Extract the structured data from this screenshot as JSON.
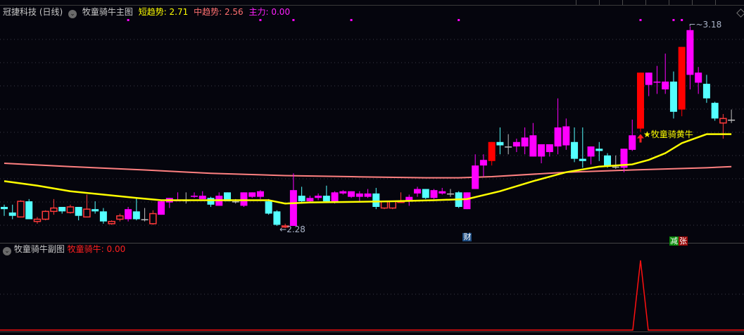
{
  "header": {
    "stock_name": "冠捷科技 (日线)",
    "indicator_name": "牧童骑牛主图",
    "short_trend_label": "短趋势: 2.71",
    "mid_trend_label": "中趋势: 2.56",
    "main_force_label": "主力: 0.00"
  },
  "sub_header": {
    "indicator_name": "牧童骑牛副图",
    "value_label": "牧童骑牛: 0.00"
  },
  "annotations": {
    "high_label": "3.18",
    "low_label": "2.28",
    "signal_label": "★牧童骑黄牛",
    "badge_cai": "财",
    "badge_jian": "减",
    "badge_zhang": "张"
  },
  "colors": {
    "background": "#05050d",
    "up_strong": "#ff00ff",
    "down": "#54ffff",
    "up_red": "#ff0000",
    "hollow": "#ff3a3a",
    "doji": "#c0c0c0",
    "short_trend": "#ffff00",
    "mid_trend": "#ff8080"
  },
  "chart_data": {
    "type": "candlestick",
    "price_axis_range": [
      2.28,
      3.18
    ],
    "candles": [
      [
        2.375,
        2.365,
        2.385,
        2.335,
        "c"
      ],
      [
        2.35,
        2.335,
        2.385,
        2.32,
        "c"
      ],
      [
        2.33,
        2.4,
        2.405,
        2.33,
        "h"
      ],
      [
        2.4,
        2.32,
        2.41,
        2.32,
        "c"
      ],
      [
        2.31,
        2.32,
        2.33,
        2.3,
        "h"
      ],
      [
        2.32,
        2.355,
        2.36,
        2.315,
        "h"
      ],
      [
        2.355,
        2.37,
        2.41,
        2.34,
        "h"
      ],
      [
        2.375,
        2.355,
        2.375,
        2.345,
        "c"
      ],
      [
        2.35,
        2.375,
        2.385,
        2.345,
        "h"
      ],
      [
        2.375,
        2.335,
        2.375,
        2.315,
        "c"
      ],
      [
        2.33,
        2.365,
        2.43,
        2.33,
        "h"
      ],
      [
        2.365,
        2.355,
        2.4,
        2.345,
        "c"
      ],
      [
        2.355,
        2.31,
        2.37,
        2.3,
        "c"
      ],
      [
        2.3,
        2.31,
        2.315,
        2.295,
        "h"
      ],
      [
        2.32,
        2.335,
        2.345,
        2.31,
        "h"
      ],
      [
        2.32,
        2.365,
        2.375,
        2.31,
        "m"
      ],
      [
        2.355,
        2.32,
        2.415,
        2.315,
        "c"
      ],
      [
        2.32,
        2.32,
        2.37,
        2.31,
        "w"
      ],
      [
        2.3,
        2.345,
        2.36,
        2.295,
        "h"
      ],
      [
        2.34,
        2.4,
        2.405,
        2.34,
        "m"
      ],
      [
        2.395,
        2.415,
        2.415,
        2.37,
        "m"
      ],
      [
        2.4,
        2.405,
        2.44,
        2.4,
        "m"
      ],
      [
        2.405,
        2.405,
        2.44,
        2.39,
        "w"
      ],
      [
        2.42,
        2.425,
        2.44,
        2.415,
        "m"
      ],
      [
        2.41,
        2.425,
        2.445,
        2.41,
        "m"
      ],
      [
        2.415,
        2.385,
        2.42,
        2.375,
        "c"
      ],
      [
        2.38,
        2.425,
        2.44,
        2.38,
        "m"
      ],
      [
        2.44,
        2.4,
        2.44,
        2.4,
        "c"
      ],
      [
        2.4,
        2.4,
        2.41,
        2.39,
        "w"
      ],
      [
        2.38,
        2.44,
        2.44,
        2.375,
        "m"
      ],
      [
        2.42,
        2.44,
        2.44,
        2.415,
        "m"
      ],
      [
        2.42,
        2.445,
        2.45,
        2.41,
        "m"
      ],
      [
        2.4,
        2.345,
        2.41,
        2.34,
        "c"
      ],
      [
        2.355,
        2.295,
        2.36,
        2.29,
        "c"
      ],
      [
        2.285,
        2.29,
        2.3,
        2.28,
        "h"
      ],
      [
        2.29,
        2.45,
        2.525,
        2.29,
        "m"
      ],
      [
        2.425,
        2.4,
        2.465,
        2.39,
        "c"
      ],
      [
        2.4,
        2.415,
        2.425,
        2.395,
        "m"
      ],
      [
        2.415,
        2.425,
        2.435,
        2.405,
        "m"
      ],
      [
        2.425,
        2.4,
        2.47,
        2.395,
        "c"
      ],
      [
        2.395,
        2.44,
        2.445,
        2.39,
        "m"
      ],
      [
        2.435,
        2.445,
        2.45,
        2.43,
        "m"
      ],
      [
        2.42,
        2.445,
        2.445,
        2.415,
        "m"
      ],
      [
        2.42,
        2.435,
        2.445,
        2.4,
        "m"
      ],
      [
        2.42,
        2.435,
        2.455,
        2.415,
        "m"
      ],
      [
        2.435,
        2.375,
        2.46,
        2.365,
        "c"
      ],
      [
        2.37,
        2.4,
        2.4,
        2.365,
        "h"
      ],
      [
        2.37,
        2.4,
        2.4,
        2.365,
        "h"
      ],
      [
        2.395,
        2.4,
        2.44,
        2.395,
        "h"
      ],
      [
        2.4,
        2.42,
        2.43,
        2.38,
        "m"
      ],
      [
        2.435,
        2.455,
        2.465,
        2.42,
        "m"
      ],
      [
        2.455,
        2.415,
        2.455,
        2.41,
        "c"
      ],
      [
        2.415,
        2.45,
        2.455,
        2.41,
        "m"
      ],
      [
        2.435,
        2.445,
        2.46,
        2.43,
        "m"
      ],
      [
        2.435,
        2.435,
        2.455,
        2.42,
        "w"
      ],
      [
        2.44,
        2.375,
        2.445,
        2.37,
        "c"
      ],
      [
        2.365,
        2.44,
        2.44,
        2.365,
        "m"
      ],
      [
        2.455,
        2.56,
        2.61,
        2.455,
        "m"
      ],
      [
        2.56,
        2.585,
        2.61,
        2.51,
        "m"
      ],
      [
        2.58,
        2.665,
        2.665,
        2.56,
        "r"
      ],
      [
        2.665,
        2.65,
        2.73,
        2.61,
        "c"
      ],
      [
        2.645,
        2.645,
        2.7,
        2.61,
        "w"
      ],
      [
        2.645,
        2.665,
        2.68,
        2.62,
        "m"
      ],
      [
        2.645,
        2.685,
        2.73,
        2.61,
        "m"
      ],
      [
        2.6,
        2.695,
        2.75,
        2.6,
        "m"
      ],
      [
        2.6,
        2.655,
        2.655,
        2.57,
        "m"
      ],
      [
        2.62,
        2.655,
        2.655,
        2.6,
        "m"
      ],
      [
        2.645,
        2.73,
        2.86,
        2.61,
        "m"
      ],
      [
        2.65,
        2.735,
        2.77,
        2.63,
        "m"
      ],
      [
        2.665,
        2.59,
        2.73,
        2.575,
        "c"
      ],
      [
        2.59,
        2.58,
        2.73,
        2.55,
        "c"
      ],
      [
        2.6,
        2.645,
        2.645,
        2.565,
        "m"
      ],
      [
        2.635,
        2.625,
        2.665,
        2.58,
        "c"
      ],
      [
        2.605,
        2.56,
        2.615,
        2.55,
        "c"
      ],
      [
        2.555,
        2.555,
        2.605,
        2.545,
        "w"
      ],
      [
        2.55,
        2.635,
        2.635,
        2.53,
        "m"
      ],
      [
        2.63,
        2.695,
        2.765,
        2.625,
        "m"
      ],
      [
        2.725,
        2.975,
        2.975,
        2.71,
        "r"
      ],
      [
        2.92,
        2.975,
        2.975,
        2.87,
        "m"
      ],
      [
        2.93,
        2.935,
        3.005,
        2.88,
        "m"
      ],
      [
        2.9,
        2.935,
        3.06,
        2.88,
        "m"
      ],
      [
        2.935,
        2.8,
        2.98,
        2.77,
        "c"
      ],
      [
        2.81,
        3.09,
        3.09,
        2.78,
        "r"
      ],
      [
        2.965,
        3.165,
        3.18,
        2.9,
        "m"
      ],
      [
        2.93,
        2.975,
        3.0,
        2.88,
        "m"
      ],
      [
        2.925,
        2.86,
        2.965,
        2.84,
        "c"
      ],
      [
        2.84,
        2.77,
        2.845,
        2.76,
        "c"
      ],
      [
        2.75,
        2.77,
        2.79,
        2.68,
        "h"
      ],
      [
        2.765,
        2.765,
        2.81,
        2.75,
        "w"
      ]
    ],
    "short_trend_line": [
      [
        0,
        2.49
      ],
      [
        4,
        2.47
      ],
      [
        8,
        2.445
      ],
      [
        12,
        2.43
      ],
      [
        16,
        2.415
      ],
      [
        19,
        2.405
      ],
      [
        28,
        2.405
      ],
      [
        32,
        2.405
      ],
      [
        34,
        2.39
      ],
      [
        37,
        2.395
      ],
      [
        47,
        2.4
      ],
      [
        52,
        2.405
      ],
      [
        56,
        2.41
      ],
      [
        60,
        2.445
      ],
      [
        64,
        2.49
      ],
      [
        68,
        2.53
      ],
      [
        72,
        2.555
      ],
      [
        76,
        2.565
      ],
      [
        78,
        2.585
      ],
      [
        80,
        2.615
      ],
      [
        82,
        2.66
      ],
      [
        85,
        2.7
      ],
      [
        88,
        2.7
      ]
    ],
    "mid_trend_line": [
      [
        0,
        2.57
      ],
      [
        8,
        2.555
      ],
      [
        17,
        2.54
      ],
      [
        25,
        2.525
      ],
      [
        34,
        2.515
      ],
      [
        42,
        2.51
      ],
      [
        51,
        2.505
      ],
      [
        55,
        2.505
      ],
      [
        59,
        2.51
      ],
      [
        68,
        2.53
      ],
      [
        76,
        2.54
      ],
      [
        85,
        2.55
      ],
      [
        88,
        2.555
      ]
    ],
    "top_markers": [
      15,
      31,
      35,
      42,
      55,
      77,
      81,
      82
    ],
    "high_index": 83,
    "low_index": 34,
    "signal_index": 77,
    "badge_cai_index": 56,
    "badge_jianzhang_index": 81,
    "sub_chart": {
      "values_range": [
        0,
        1
      ],
      "spikes": [
        {
          "index": 77,
          "value": 1
        }
      ]
    }
  }
}
